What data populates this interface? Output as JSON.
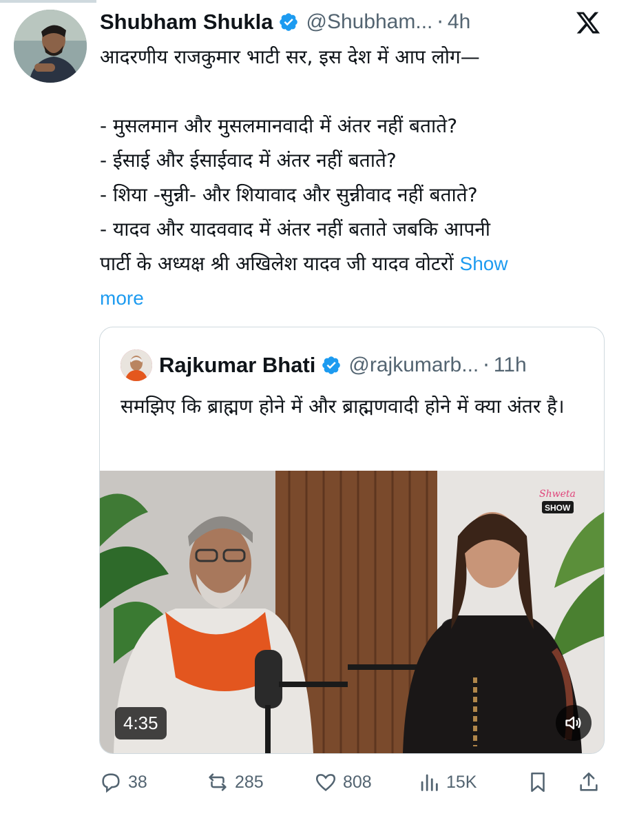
{
  "tweet": {
    "author_name": "Shubham Shukla",
    "author_handle": "@Shubham...",
    "time": "4h",
    "separator": "·",
    "body_lines": "आदरणीय राजकुमार भाटी सर, इस देश में आप लोग—\n\n- मुसलमान और मुसलमानवादी में अंतर नहीं बताते?\n- ईसाई और ईसाईवाद में अंतर नहीं बताते?\n- शिया -सुन्नी- और शियावाद और सुन्नीवाद नहीं बताते?\n- यादव और यादववाद में अंतर नहीं बताते जबकि आपनी\nपार्टी के अध्यक्ष श्री अखिलेश यादव जी यादव वोटरों ",
    "show_more": "Show\nmore"
  },
  "quote": {
    "author_name": "Rajkumar Bhati",
    "author_handle": "@rajkumarb...",
    "time": "11h",
    "separator": "·",
    "text": "समझिए कि ब्राह्मण होने में और ब्राह्मणवादी होने में क्या अंतर है।",
    "video_duration": "4:35",
    "video_logo_text": "Shweta",
    "video_logo_sub": "SHOW"
  },
  "actions": {
    "replies": "38",
    "reposts": "285",
    "likes": "808",
    "views": "15K"
  },
  "colors": {
    "accent": "#1d9bf0",
    "secondary_text": "#536471",
    "border": "#cfd9de"
  },
  "icons": [
    "verified-badge-icon",
    "x-logo-icon",
    "reply-icon",
    "repost-icon",
    "like-icon",
    "views-icon",
    "bookmark-icon",
    "share-icon",
    "volume-icon"
  ]
}
